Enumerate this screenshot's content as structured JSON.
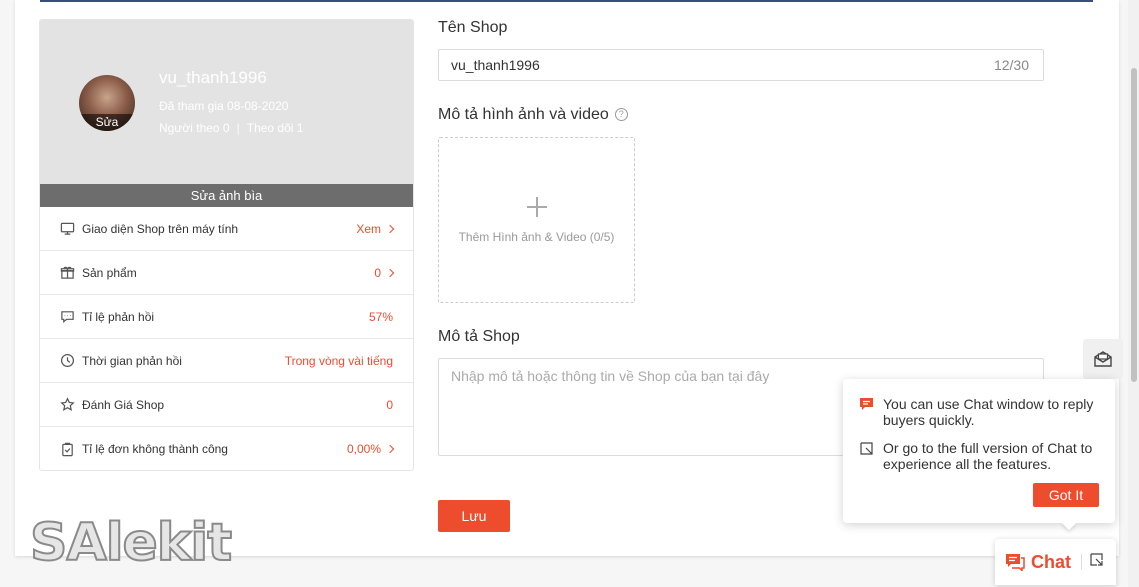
{
  "profile": {
    "username": "vu_thanh1996",
    "avatar_edit": "Sửa",
    "joined": "Đã tham gia 08-08-2020",
    "followers": "Người theo 0",
    "separator": "|",
    "following": "Theo dõi 1",
    "edit_cover": "Sửa ảnh bìa"
  },
  "stats": [
    {
      "icon": "monitor-icon",
      "label": "Giao diện Shop trên máy tính",
      "value": "Xem",
      "link": true
    },
    {
      "icon": "gift-icon",
      "label": "Sản phẩm",
      "value": "0",
      "link": true
    },
    {
      "icon": "chat-bubble-icon",
      "label": "Tỉ lệ phản hồi",
      "value": "57%",
      "link": false
    },
    {
      "icon": "clock-icon",
      "label": "Thời gian phản hồi",
      "value": "Trong vòng vài tiếng",
      "link": false
    },
    {
      "icon": "star-icon",
      "label": "Đánh Giá Shop",
      "value": "0",
      "link": false
    },
    {
      "icon": "clipboard-icon",
      "label": "Tỉ lệ đơn không thành công",
      "value": "0,00%",
      "link": true
    }
  ],
  "form": {
    "shop_name_label": "Tên Shop",
    "shop_name_value": "vu_thanh1996",
    "shop_name_count": "12/30",
    "media_label": "Mô tả hình ảnh và video",
    "help_glyph": "?",
    "upload_text": "Thêm Hình ảnh & Video (0/5)",
    "desc_label": "Mô tả Shop",
    "desc_placeholder": "Nhập mô tả hoặc thông tin về Shop của bạn tại đây",
    "save_label": "Lưu"
  },
  "chat": {
    "tip_line1": "You can use Chat window to reply buyers quickly.",
    "tip_line2": "Or go to the full version of Chat to experience all the features.",
    "got_it": "Got It",
    "chat_label": "Chat"
  },
  "watermark": "SAlekit",
  "colors": {
    "accent": "#ee4d2d",
    "cover": "#e3e3e3",
    "edit_cover_bar": "#6d6d6d"
  }
}
